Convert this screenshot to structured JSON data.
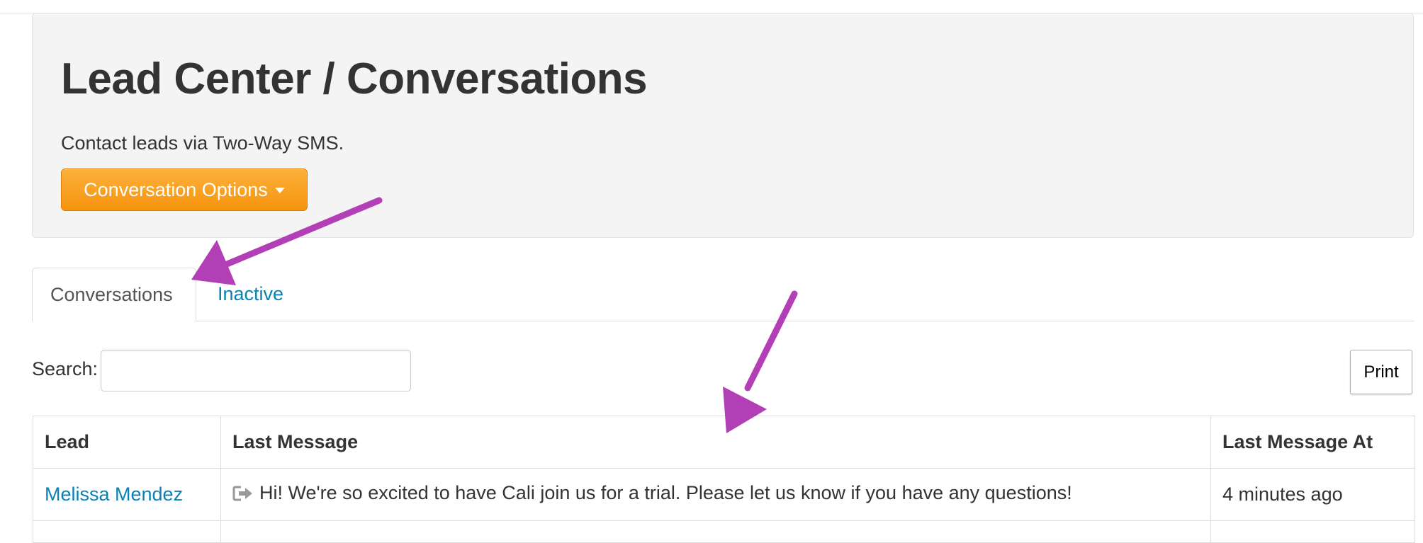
{
  "header": {
    "title": "Lead Center / Conversations",
    "subtitle": "Contact leads via Two-Way SMS.",
    "options_button": "Conversation Options"
  },
  "tabs": [
    {
      "label": "Conversations",
      "active": true
    },
    {
      "label": "Inactive",
      "active": false
    }
  ],
  "search": {
    "label": "Search:",
    "value": ""
  },
  "print_button": "Print",
  "table": {
    "columns": [
      "Lead",
      "Last Message",
      "Last Message At"
    ],
    "rows": [
      {
        "lead": "Melissa Mendez",
        "icon": "outgoing-message-icon",
        "last_message": "Hi! We're so excited to have Cali join us for a trial. Please let us know if you have any questions!",
        "last_message_at": "4 minutes ago"
      }
    ]
  },
  "colors": {
    "accent_orange": "#f7930e",
    "link_blue": "#0a82b4",
    "annotation_arrow": "#b33fb6"
  }
}
